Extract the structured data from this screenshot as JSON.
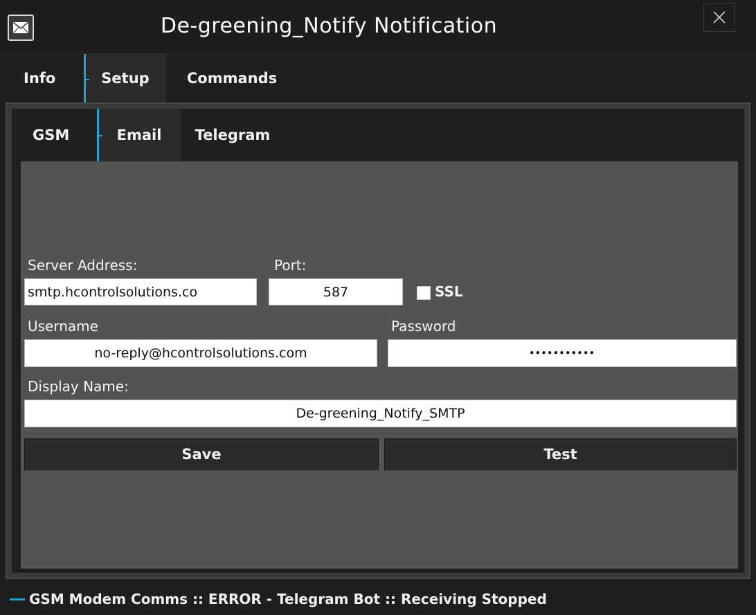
{
  "window": {
    "title": "De-greening_Notify Notification",
    "icon": "envelope-icon",
    "close_icon": "close-icon"
  },
  "main_tabs": [
    {
      "label": "Info"
    },
    {
      "label": "Setup"
    },
    {
      "label": "Commands"
    }
  ],
  "main_tabs_selected": "Setup",
  "sub_tabs": [
    {
      "label": "GSM"
    },
    {
      "label": "Email"
    },
    {
      "label": "Telegram"
    }
  ],
  "sub_tabs_selected": "Email",
  "email_form": {
    "server_address_label": "Server Address:",
    "server_address_value": "smtp.hcontrolsolutions.co",
    "port_label": "Port:",
    "port_value": "587",
    "ssl_label": "SSL",
    "ssl_checked": false,
    "username_label": "Username",
    "username_value": "no-reply@hcontrolsolutions.com",
    "password_label": "Password",
    "password_masked": "•••••••••••",
    "display_name_label": "Display Name:",
    "display_name_value": "De-greening_Notify_SMTP",
    "save_label": "Save",
    "test_label": "Test"
  },
  "status_bar": {
    "text": "GSM Modem Comms :: ERROR - Telegram Bot :: Receiving Stopped"
  },
  "colors": {
    "accent": "#1aa3d4",
    "window_bg": "#1f1f1f",
    "panel_bg": "#535353",
    "button_bg": "#2a2a2a",
    "text": "#ffffff"
  }
}
